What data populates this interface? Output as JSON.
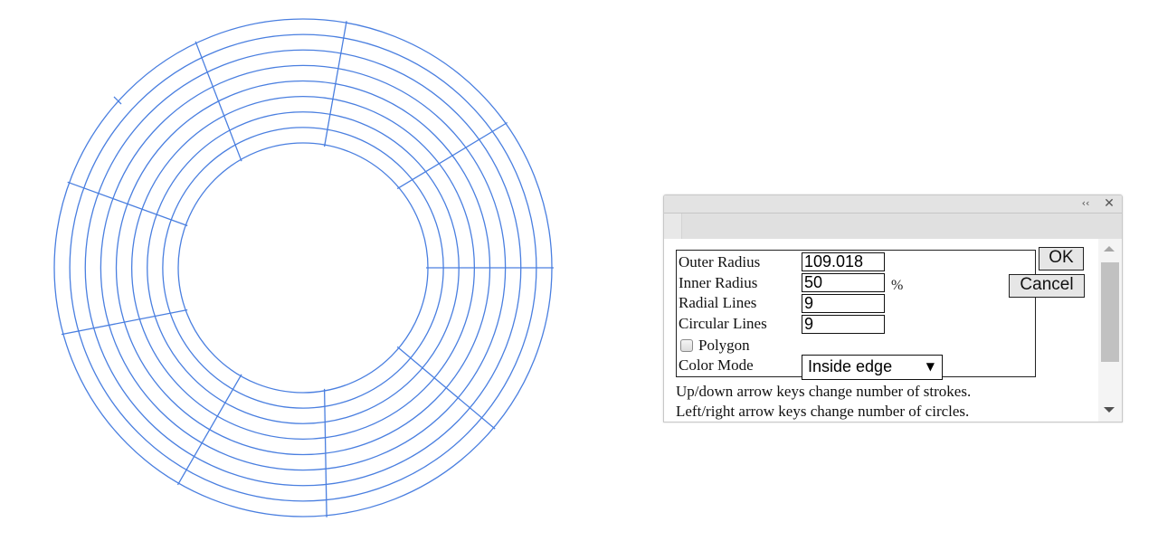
{
  "drawing": {
    "stroke_color": "#4a7fe0",
    "radial_angles_deg": [
      0,
      40,
      80,
      120,
      160,
      200,
      240,
      280,
      320
    ],
    "circle_count": 9
  },
  "dialog": {
    "collapse_icon": "double-chevron-left-icon",
    "collapse_glyph": "‹‹",
    "close_icon": "close-icon",
    "close_glyph": "✕",
    "fields": {
      "outer_radius": {
        "label": "Outer Radius",
        "value": "109.018"
      },
      "inner_radius": {
        "label": "Inner Radius",
        "value": "50"
      },
      "radial_lines": {
        "label": "Radial Lines",
        "value": "9"
      },
      "circular_lines": {
        "label": "Circular Lines",
        "value": "9"
      }
    },
    "percent_unit": "%",
    "polygon": {
      "label": "Polygon",
      "checked": false
    },
    "color_mode": {
      "label": "Color Mode",
      "selected": "Inside edge"
    },
    "ok_label": "OK",
    "cancel_label": "Cancel",
    "hints": [
      "Up/down arrow keys change number of strokes.",
      "Left/right arrow keys change number of circles."
    ]
  }
}
